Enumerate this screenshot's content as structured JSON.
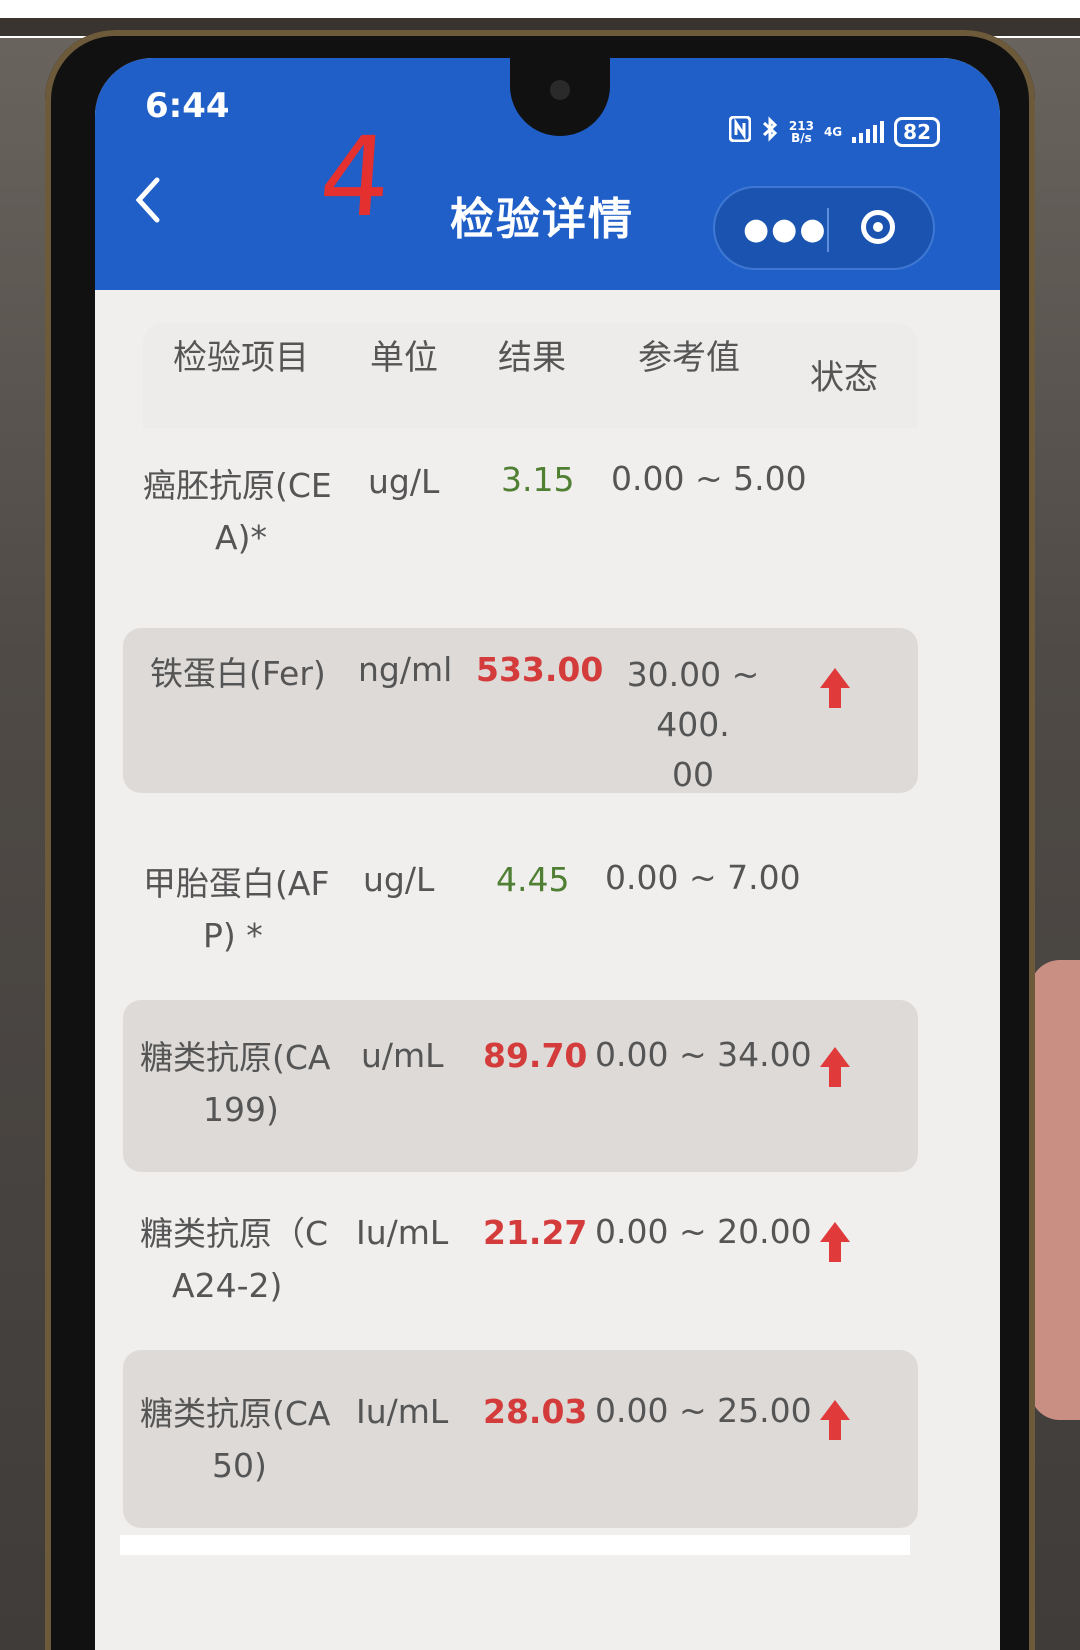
{
  "status_bar": {
    "time": "6:44",
    "net_speed_top": "213",
    "net_speed_bottom": "B/s",
    "network_type": "4G",
    "battery": "82"
  },
  "annotation": "4",
  "nav": {
    "title": "检验详情",
    "more_icon": "more-dots-icon",
    "close_icon": "target-icon"
  },
  "table": {
    "headers": {
      "item": "检验项目",
      "unit": "单位",
      "result": "结果",
      "reference": "参考值",
      "status": "状态"
    },
    "rows": [
      {
        "name_l1": "癌胚抗原(CE",
        "name_l2": "A)*",
        "unit": "ug/L",
        "result": "3.15",
        "ref_l1": "0.00 ~ 5.00",
        "ref_l2": "",
        "status": "normal"
      },
      {
        "name_l1": "铁蛋白(Fer)",
        "name_l2": "",
        "unit": "ng/ml",
        "result": "533.00",
        "ref_l1": "30.00 ~ 400.",
        "ref_l2": "00",
        "status": "high"
      },
      {
        "name_l1": "甲胎蛋白(AF",
        "name_l2": "P) *",
        "unit": "ug/L",
        "result": "4.45",
        "ref_l1": "0.00 ~ 7.00",
        "ref_l2": "",
        "status": "normal"
      },
      {
        "name_l1": "糖类抗原(CA",
        "name_l2": "199)",
        "unit": "u/mL",
        "result": "89.70",
        "ref_l1": "0.00 ~ 34.00",
        "ref_l2": "",
        "status": "high"
      },
      {
        "name_l1": "糖类抗原（C",
        "name_l2": "A24-2)",
        "unit": "Iu/mL",
        "result": "21.27",
        "ref_l1": "0.00 ~ 20.00",
        "ref_l2": "",
        "status": "high"
      },
      {
        "name_l1": "糖类抗原(CA",
        "name_l2": "50)",
        "unit": "Iu/mL",
        "result": "28.03",
        "ref_l1": "0.00 ~ 25.00",
        "ref_l2": "",
        "status": "high"
      }
    ]
  },
  "colors": {
    "header_blue": "#1f5fc7",
    "high_red": "#d43c3c",
    "normal_green": "#4f7f32"
  }
}
